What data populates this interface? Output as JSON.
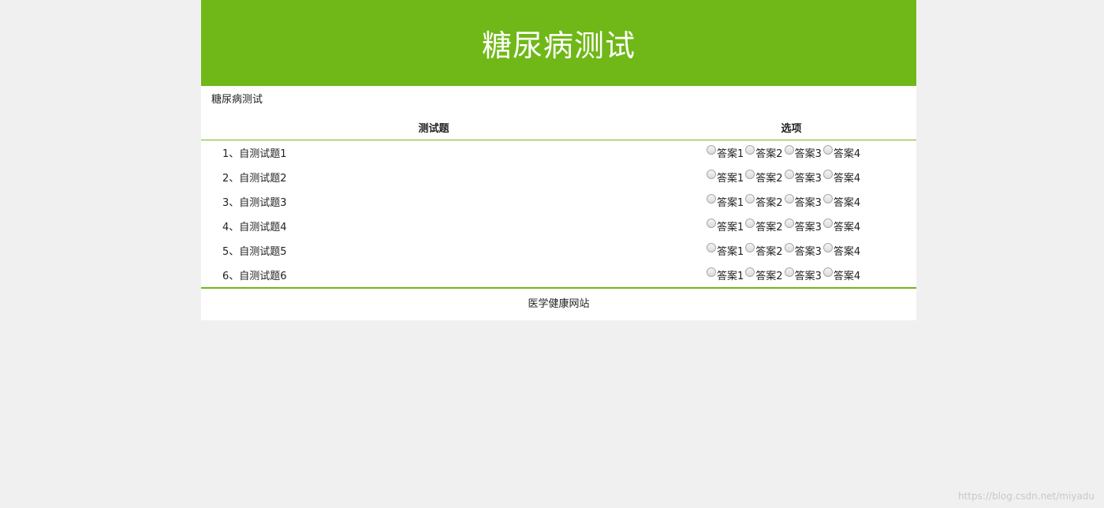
{
  "header": {
    "title": "糖尿病测试"
  },
  "section": {
    "title": "糖尿病测试"
  },
  "table": {
    "columns": [
      "测试题",
      "选项"
    ],
    "questions": [
      {
        "label": "1、自测试题1"
      },
      {
        "label": "2、自测试题2"
      },
      {
        "label": "3、自测试题3"
      },
      {
        "label": "4、自测试题4"
      },
      {
        "label": "5、自测试题5"
      },
      {
        "label": "6、自测试题6"
      }
    ],
    "options": [
      "答案1",
      "答案2",
      "答案3",
      "答案4"
    ]
  },
  "footer": {
    "text": "医学健康网站"
  },
  "watermark": {
    "text": "https://blog.csdn.net/miyadu"
  },
  "colors": {
    "accent": "#6fb817",
    "background": "#f0f0f0"
  }
}
